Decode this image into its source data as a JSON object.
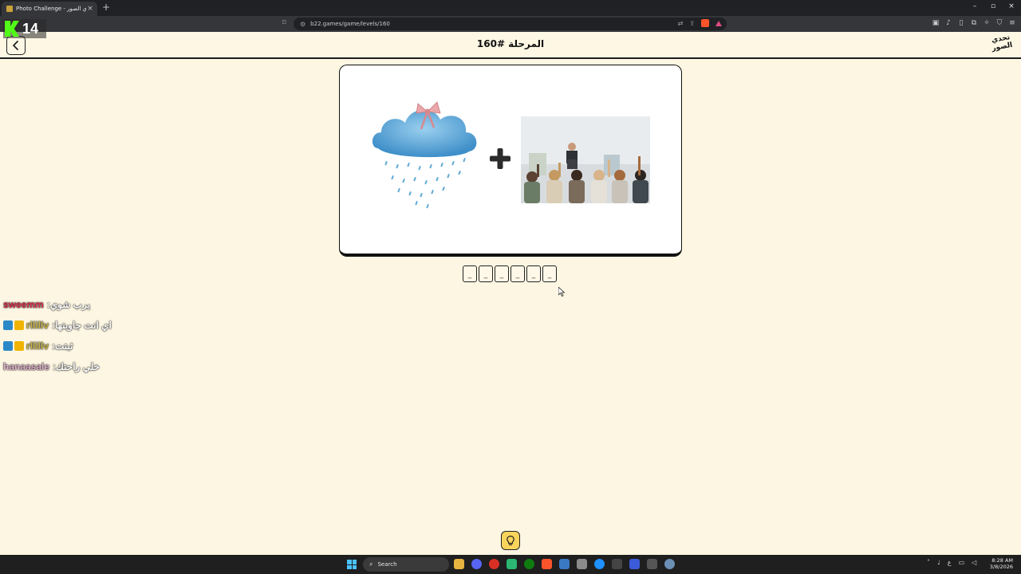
{
  "browser": {
    "tab_title": "Photo Challenge - تحدي الصور",
    "tab_close": "×",
    "new_tab": "+",
    "url": "b22.games/game/levels/160",
    "window_controls": [
      "–",
      "▫",
      "×"
    ]
  },
  "stream_overlay": {
    "viewer_count": "14",
    "brand_color": "#53fc18"
  },
  "header": {
    "back_icon": "chevron-left-icon",
    "level_title": "المرحلة #160",
    "logo_text": "تحدي الصور"
  },
  "puzzle": {
    "image_left": "rain-cloud-with-bow",
    "operator": "+",
    "image_right": "audience-raising-hands"
  },
  "answer": {
    "slots": [
      "_",
      "_",
      "_",
      "_",
      "_",
      "_"
    ]
  },
  "chat": [
    {
      "user": "sweemm",
      "separator": " : ",
      "message": "يرب شوي",
      "color": "#e0344d",
      "badges": []
    },
    {
      "user": "rllillv",
      "separator": " : ",
      "message": "اي انت جاوبتها",
      "color": "#c8b44a",
      "badges": [
        "blue",
        "gold"
      ]
    },
    {
      "user": "rllillv",
      "separator": " : ",
      "message": "ثبتت",
      "color": "#c8b44a",
      "badges": [
        "blue",
        "gold"
      ]
    },
    {
      "user": "hanaasale",
      "separator": " : ",
      "message": "خلي راحتك",
      "color": "#e2b3cf",
      "badges": []
    }
  ],
  "hint": {
    "icon": "lightbulb-icon"
  },
  "taskbar": {
    "search_placeholder": "Search",
    "time": "8:28 AM",
    "date": "3/8/2026",
    "lang": "ع"
  }
}
